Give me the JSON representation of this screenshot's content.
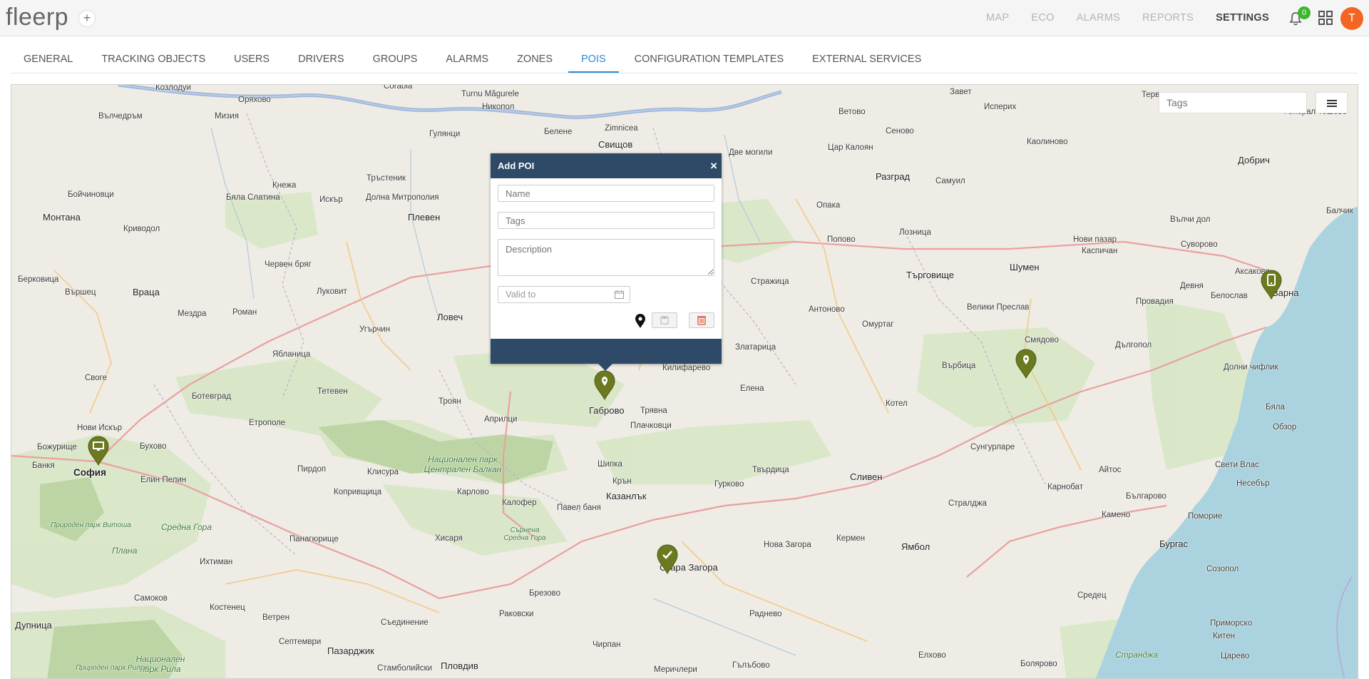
{
  "app": {
    "logo": "fleerp",
    "add_label": "+",
    "nav": [
      {
        "label": "MAP"
      },
      {
        "label": "ECO"
      },
      {
        "label": "ALARMS"
      },
      {
        "label": "REPORTS"
      },
      {
        "label": "SETTINGS",
        "active": true
      }
    ],
    "notifications_count": "0",
    "avatar_initial": "T",
    "accent": "#2d8ad6",
    "avatar_color": "#f26522"
  },
  "tabs": [
    {
      "label": "GENERAL"
    },
    {
      "label": "TRACKING OBJECTS"
    },
    {
      "label": "USERS"
    },
    {
      "label": "DRIVERS"
    },
    {
      "label": "GROUPS"
    },
    {
      "label": "ALARMS"
    },
    {
      "label": "ZONES"
    },
    {
      "label": "POIS",
      "active": true
    },
    {
      "label": "CONFIGURATION TEMPLATES"
    },
    {
      "label": "EXTERNAL SERVICES"
    }
  ],
  "map": {
    "tags_placeholder": "Tags",
    "layers_icon": "list-icon",
    "marker_color": "#6b7a1f",
    "places": [
      {
        "name": "Козлодуй"
      },
      {
        "name": "Оряхово"
      },
      {
        "name": "Corabia"
      },
      {
        "name": "Turnu Măgurele"
      },
      {
        "name": "Никопол"
      },
      {
        "name": "Zimnicea"
      },
      {
        "name": "Свищов"
      },
      {
        "name": "Белене"
      },
      {
        "name": "Гулянци"
      },
      {
        "name": "Вълчедръм"
      },
      {
        "name": "Мизия"
      },
      {
        "name": "Бойчиновци"
      },
      {
        "name": "Кнежа"
      },
      {
        "name": "Бяла Слатина"
      },
      {
        "name": "Искър"
      },
      {
        "name": "Тръстеник"
      },
      {
        "name": "Долна Митрополия"
      },
      {
        "name": "Плевен"
      },
      {
        "name": "Монтана"
      },
      {
        "name": "Криводол"
      },
      {
        "name": "Червен бряг"
      },
      {
        "name": "Луковит"
      },
      {
        "name": "Берковица"
      },
      {
        "name": "Вършец"
      },
      {
        "name": "Враца"
      },
      {
        "name": "Мездра"
      },
      {
        "name": "Роман"
      },
      {
        "name": "Угърчин"
      },
      {
        "name": "Ловеч"
      },
      {
        "name": "Ябланица"
      },
      {
        "name": "Своге"
      },
      {
        "name": "Ботевград"
      },
      {
        "name": "Тетевен"
      },
      {
        "name": "Троян"
      },
      {
        "name": "Етрополе"
      },
      {
        "name": "Нови Искър"
      },
      {
        "name": "Бухово"
      },
      {
        "name": "Божурище"
      },
      {
        "name": "Банкя"
      },
      {
        "name": "София"
      },
      {
        "name": "Елин Пелин"
      },
      {
        "name": "Пирдоп"
      },
      {
        "name": "Клисура"
      },
      {
        "name": "Копривщица"
      },
      {
        "name": "Априлци"
      },
      {
        "name": "Карлово"
      },
      {
        "name": "Калофер"
      },
      {
        "name": "Павел баня"
      },
      {
        "name": "Казанлък"
      },
      {
        "name": "Шипка"
      },
      {
        "name": "Крън"
      },
      {
        "name": "Габрово"
      },
      {
        "name": "Трявна"
      },
      {
        "name": "Плачковци"
      },
      {
        "name": "Килифарево"
      },
      {
        "name": "Елена"
      },
      {
        "name": "Златарица"
      },
      {
        "name": "Стара Загора"
      },
      {
        "name": "Гурково"
      },
      {
        "name": "Твърдица"
      },
      {
        "name": "Нова Загора"
      },
      {
        "name": "Сливен"
      },
      {
        "name": "Кермен"
      },
      {
        "name": "Ямбол"
      },
      {
        "name": "Стралджа"
      },
      {
        "name": "Котел"
      },
      {
        "name": "Омуртаг"
      },
      {
        "name": "Антоново"
      },
      {
        "name": "Стражица"
      },
      {
        "name": "Попово"
      },
      {
        "name": "Опака"
      },
      {
        "name": "Разград"
      },
      {
        "name": "Лозница"
      },
      {
        "name": "Търговище"
      },
      {
        "name": "Шумен"
      },
      {
        "name": "Велики Преслав"
      },
      {
        "name": "Смядово"
      },
      {
        "name": "Върбица"
      },
      {
        "name": "Нови пазар"
      },
      {
        "name": "Каспичан"
      },
      {
        "name": "Провадия"
      },
      {
        "name": "Девня"
      },
      {
        "name": "Белослав"
      },
      {
        "name": "Аксаково"
      },
      {
        "name": "Варна"
      },
      {
        "name": "Дългопол"
      },
      {
        "name": "Долни чифлик"
      },
      {
        "name": "Бяла"
      },
      {
        "name": "Обзор"
      },
      {
        "name": "Суворово"
      },
      {
        "name": "Вълчи дол"
      },
      {
        "name": "Добрич"
      },
      {
        "name": "Балчик"
      },
      {
        "name": "Генерал Тошево"
      },
      {
        "name": "Тервел"
      },
      {
        "name": "Исперих"
      },
      {
        "name": "Завет"
      },
      {
        "name": "Ветово"
      },
      {
        "name": "Сеново"
      },
      {
        "name": "Цар Калоян"
      },
      {
        "name": "Самуил"
      },
      {
        "name": "Каолиново"
      },
      {
        "name": "Две могили"
      },
      {
        "name": "Сунгурларе"
      },
      {
        "name": "Карнобат"
      },
      {
        "name": "Айтос"
      },
      {
        "name": "Несебър"
      },
      {
        "name": "Свети Влас"
      },
      {
        "name": "Поморие"
      },
      {
        "name": "Бургас"
      },
      {
        "name": "Камено"
      },
      {
        "name": "Българово"
      },
      {
        "name": "Созопол"
      },
      {
        "name": "Средец"
      },
      {
        "name": "Приморско"
      },
      {
        "name": "Китен"
      },
      {
        "name": "Царево"
      },
      {
        "name": "Странджа"
      },
      {
        "name": "Болярово"
      },
      {
        "name": "Елхово"
      },
      {
        "name": "Гълъбово"
      },
      {
        "name": "Раднево"
      },
      {
        "name": "Меричлери"
      },
      {
        "name": "Чирпан"
      },
      {
        "name": "Брезово"
      },
      {
        "name": "Раковски"
      },
      {
        "name": "Пловдив"
      },
      {
        "name": "Стамболийски"
      },
      {
        "name": "Съединение"
      },
      {
        "name": "Хисаря"
      },
      {
        "name": "Пазарджик"
      },
      {
        "name": "Септември"
      },
      {
        "name": "Ветрен"
      },
      {
        "name": "Панагюрище"
      },
      {
        "name": "Костенец"
      },
      {
        "name": "Самоков"
      },
      {
        "name": "Ихтиман"
      },
      {
        "name": "Дупница"
      },
      {
        "name": "Плана"
      },
      {
        "name": "Средна Гора"
      },
      {
        "name": "Природен парк Витоша"
      },
      {
        "name": "Национален парк Централен Балкан"
      },
      {
        "name": "Сърнена Средна Гора"
      },
      {
        "name": "Национален парк Рила"
      },
      {
        "name": "Природен парк Рилски"
      },
      {
        "name": "Вършец"
      }
    ]
  },
  "popup": {
    "title": "Add POI",
    "close": "×",
    "name_placeholder": "Name",
    "tags_placeholder": "Tags",
    "description_placeholder": "Description",
    "valid_placeholder": "Valid to"
  }
}
